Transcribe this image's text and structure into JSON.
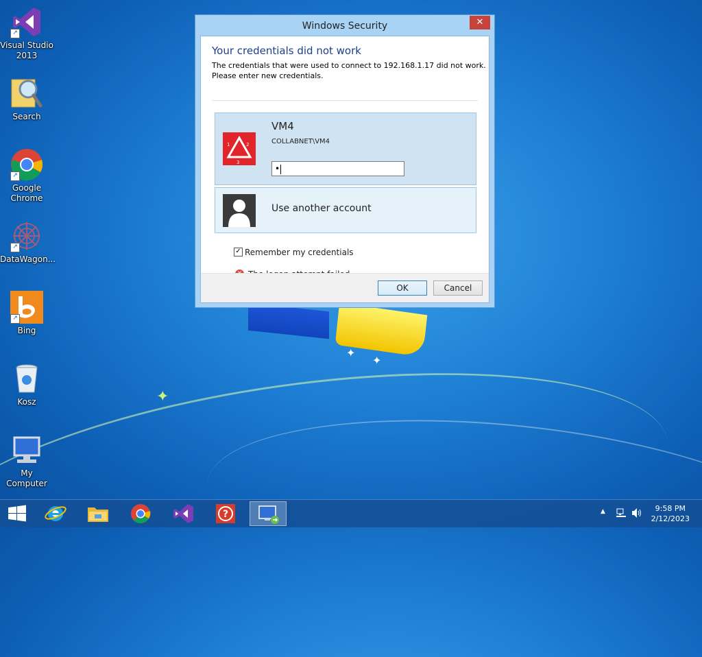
{
  "desktop": {
    "icons": [
      {
        "label_line1": "Visual Studio",
        "label_line2": "2013",
        "icon": "visual-studio-icon"
      },
      {
        "label_line1": "Search",
        "label_line2": "",
        "icon": "search-icon"
      },
      {
        "label_line1": "Google",
        "label_line2": "Chrome",
        "icon": "chrome-icon"
      },
      {
        "label_line1": "DataWagon...",
        "label_line2": "",
        "icon": "datawagon-icon"
      },
      {
        "label_line1": "Bing",
        "label_line2": "",
        "icon": "bing-icon"
      },
      {
        "label_line1": "Kosz",
        "label_line2": "",
        "icon": "recycle-bin-icon"
      },
      {
        "label_line1": "My Computer",
        "label_line2": "",
        "icon": "computer-icon"
      }
    ]
  },
  "dialog": {
    "title": "Windows Security",
    "close_glyph": "✕",
    "error_title": "Your credentials did not work",
    "error_line1": "The credentials that were used to connect to 192.168.1.17 did not work.",
    "error_line2": "Please enter new credentials.",
    "account": {
      "name": "VM4",
      "domain_user": "COLLABNET\\VM4",
      "password_value": "•"
    },
    "other_account_label": "Use another account",
    "remember_label": "Remember my credentials",
    "remember_checked": true,
    "status_text": "The logon attempt failed",
    "ok_label": "OK",
    "cancel_label": "Cancel"
  },
  "taskbar": {
    "items": [
      "start-icon",
      "internet-explorer-icon",
      "file-explorer-icon",
      "chrome-icon",
      "visual-studio-icon",
      "help-icon",
      "remote-desktop-icon"
    ],
    "active_item": "remote-desktop-icon",
    "time": "9:58 PM",
    "date": "2/12/2023"
  }
}
